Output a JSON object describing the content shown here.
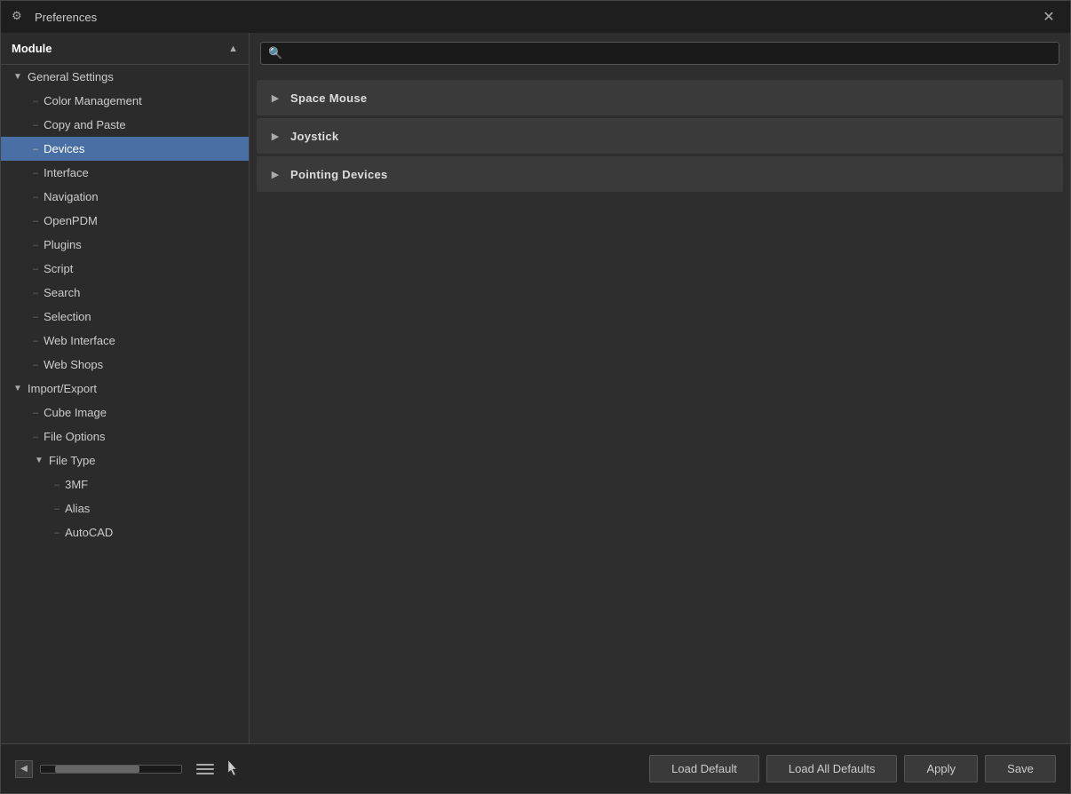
{
  "window": {
    "title": "Preferences",
    "icon": "⚙"
  },
  "sidebar": {
    "header": "Module",
    "items": [
      {
        "id": "general-settings",
        "label": "General Settings",
        "level": 0,
        "type": "expand",
        "expanded": true
      },
      {
        "id": "color-management",
        "label": "Color Management",
        "level": 1,
        "type": "child"
      },
      {
        "id": "copy-and-paste",
        "label": "Copy and Paste",
        "level": 1,
        "type": "child"
      },
      {
        "id": "devices",
        "label": "Devices",
        "level": 1,
        "type": "child",
        "active": true
      },
      {
        "id": "interface",
        "label": "Interface",
        "level": 1,
        "type": "child"
      },
      {
        "id": "navigation",
        "label": "Navigation",
        "level": 1,
        "type": "child"
      },
      {
        "id": "openpdm",
        "label": "OpenPDM",
        "level": 1,
        "type": "child"
      },
      {
        "id": "plugins",
        "label": "Plugins",
        "level": 1,
        "type": "child"
      },
      {
        "id": "script",
        "label": "Script",
        "level": 1,
        "type": "child"
      },
      {
        "id": "search",
        "label": "Search",
        "level": 1,
        "type": "child"
      },
      {
        "id": "selection",
        "label": "Selection",
        "level": 1,
        "type": "child"
      },
      {
        "id": "web-interface",
        "label": "Web Interface",
        "level": 1,
        "type": "child"
      },
      {
        "id": "web-shops",
        "label": "Web Shops",
        "level": 1,
        "type": "child"
      },
      {
        "id": "import-export",
        "label": "Import/Export",
        "level": 0,
        "type": "expand",
        "expanded": true
      },
      {
        "id": "cube-image",
        "label": "Cube Image",
        "level": 1,
        "type": "child"
      },
      {
        "id": "file-options",
        "label": "File Options",
        "level": 1,
        "type": "child"
      },
      {
        "id": "file-type",
        "label": "File Type",
        "level": 1,
        "type": "expand",
        "expanded": true
      },
      {
        "id": "3mf",
        "label": "3MF",
        "level": 2,
        "type": "child"
      },
      {
        "id": "alias",
        "label": "Alias",
        "level": 2,
        "type": "child"
      },
      {
        "id": "autocad",
        "label": "AutoCAD",
        "level": 2,
        "type": "child"
      }
    ]
  },
  "search": {
    "placeholder": ""
  },
  "content": {
    "rows": [
      {
        "id": "space-mouse",
        "label": "Space Mouse"
      },
      {
        "id": "joystick",
        "label": "Joystick"
      },
      {
        "id": "pointing-devices",
        "label": "Pointing Devices"
      }
    ]
  },
  "buttons": {
    "load_default": "Load Default",
    "load_all_defaults": "Load All Defaults",
    "apply": "Apply",
    "save": "Save"
  }
}
